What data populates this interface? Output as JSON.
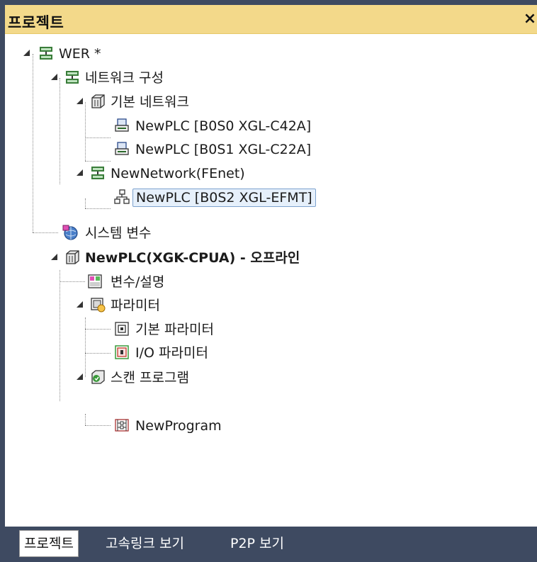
{
  "panel": {
    "title": "프로젝트",
    "close_label": "×"
  },
  "tree": {
    "root_label": "WER *",
    "network_config_label": "네트워크 구성",
    "basic_network_label": "기본 네트워크",
    "plc1_label": "NewPLC [B0S0 XGL-C42A]",
    "plc2_label": "NewPLC [B0S1 XGL-C22A]",
    "new_network_label": "NewNetwork(FEnet)",
    "plc3_label": "NewPLC [B0S2 XGL-EFMT]",
    "system_vars_label": "시스템 변수",
    "cpu_label": "NewPLC(XGK-CPUA) - 오프라인",
    "vars_desc_label": "변수/설명",
    "params_label": "파라미터",
    "basic_params_label": "기본 파라미터",
    "io_params_label": "I/O 파라미터",
    "scan_program_label": "스캔 프로그램",
    "program_label": "NewProgram"
  },
  "tabs": {
    "project": "프로젝트",
    "highspeed": "고속링크 보기",
    "p2p": "P2P 보기"
  },
  "colors": {
    "title_bg": "#f3d98a",
    "frame_bg": "#3e4a61",
    "selection_border": "#7da2ce"
  }
}
